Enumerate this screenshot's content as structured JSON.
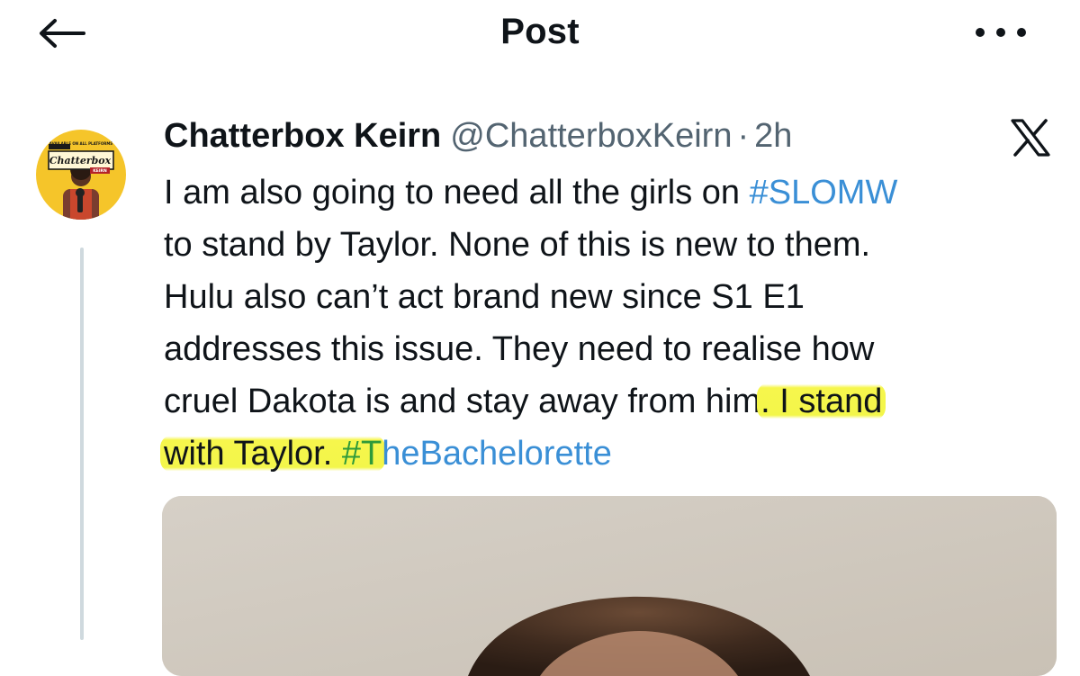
{
  "header": {
    "title": "Post",
    "back_icon": "arrow-left-icon",
    "more_icon": "more-horizontal-icon"
  },
  "post": {
    "avatar": {
      "icon": "avatar",
      "badge_small_text": "AVAILABLE ON ALL PLATFORMS",
      "badge_script_text": "Chatterbox",
      "badge_sub_text": "KEIRN"
    },
    "display_name": "Chatterbox Keirn",
    "handle": "@ChatterboxKeirn",
    "separator": "·",
    "timestamp": "2h",
    "platform_icon": "x-logo-icon",
    "lines": [
      {
        "before": "I am also going to need all the girls on ",
        "hashtag": "#SLOMW"
      },
      {
        "text": "to stand by Taylor. None of this is new to them."
      },
      {
        "text": "Hulu also can’t act brand new since S1 E1"
      },
      {
        "text": "addresses this issue. They need to realise how"
      },
      {
        "before": "cruel Dakota is and stay away from him",
        "highlight": ". I stand"
      },
      {
        "highlight": "with Taylor. #T",
        "hashtag_rest": "heBachelorette"
      }
    ]
  },
  "colors": {
    "text": "#0f1419",
    "secondary": "#536471",
    "link": "#3a8fd6",
    "highlighter": "#f3f64a",
    "thread_line": "#cfd9de",
    "avatar_yellow": "#f5c52a"
  }
}
